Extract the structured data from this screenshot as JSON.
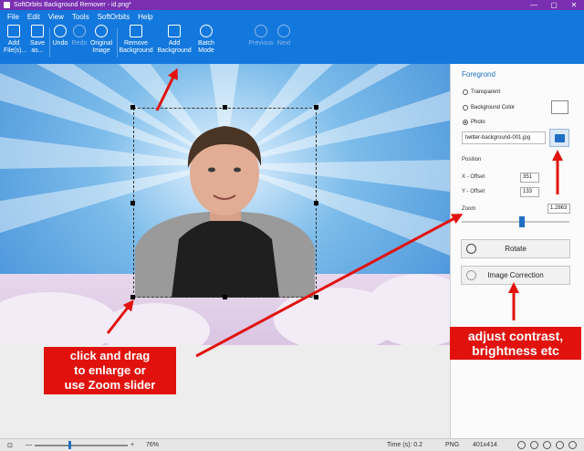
{
  "window": {
    "title": "SoftOrbits Background Remover - id.png*",
    "minimize": "—",
    "maximize": "▢",
    "close": "✕"
  },
  "menu": [
    "File",
    "Edit",
    "View",
    "Tools",
    "SoftOrbits",
    "Help"
  ],
  "toolbar": {
    "add_file": "Add File(s)...",
    "save_as": "Save as...",
    "undo": "Undo",
    "redo": "Redo",
    "original_image": "Original Image",
    "remove_background": "Remove Background",
    "add_background": "Add Background",
    "batch_mode": "Batch Mode",
    "previous": "Previous",
    "next": "Next"
  },
  "panel": {
    "header": "Foregrond",
    "radio_transparent": "Transparent",
    "radio_background_color": "Background Color",
    "radio_photo": "Photo",
    "selected_option": "Photo",
    "file_value": "twitter-background-001.jpg",
    "position_label": "Position",
    "x_label": "X - Offset",
    "x_value": "351",
    "y_label": "Y - Offset",
    "y_value": "133",
    "zoom_label": "Zoom",
    "zoom_value": "1.2863",
    "zoom_level_fraction": 0.56,
    "rotate_label": "Rotate",
    "image_correction_label": "Image Correction"
  },
  "callouts": {
    "left": "click and drag\nto enlarge or\nuse Zoom slider",
    "right": "adjust contrast,\nbrightness etc"
  },
  "statusbar": {
    "zoom_minus": "—",
    "zoom_plus": "+",
    "zoom_percent": "76%",
    "time": "Time (s): 0.2",
    "format": "PNG",
    "dimensions": "401x414",
    "zoom_level_fraction": 0.37
  },
  "colors": {
    "accent": "#1378dd",
    "title_bar": "#7a2fb1",
    "callout": "#e1120e",
    "arrow": "#e1120e"
  },
  "icons": [
    "add-file-icon",
    "save-icon",
    "undo-icon",
    "redo-icon",
    "original-image-icon",
    "remove-background-icon",
    "add-background-icon",
    "batch-mode-icon",
    "previous-icon",
    "next-icon",
    "browse-folder-icon",
    "rotate-icon",
    "image-correction-icon"
  ]
}
